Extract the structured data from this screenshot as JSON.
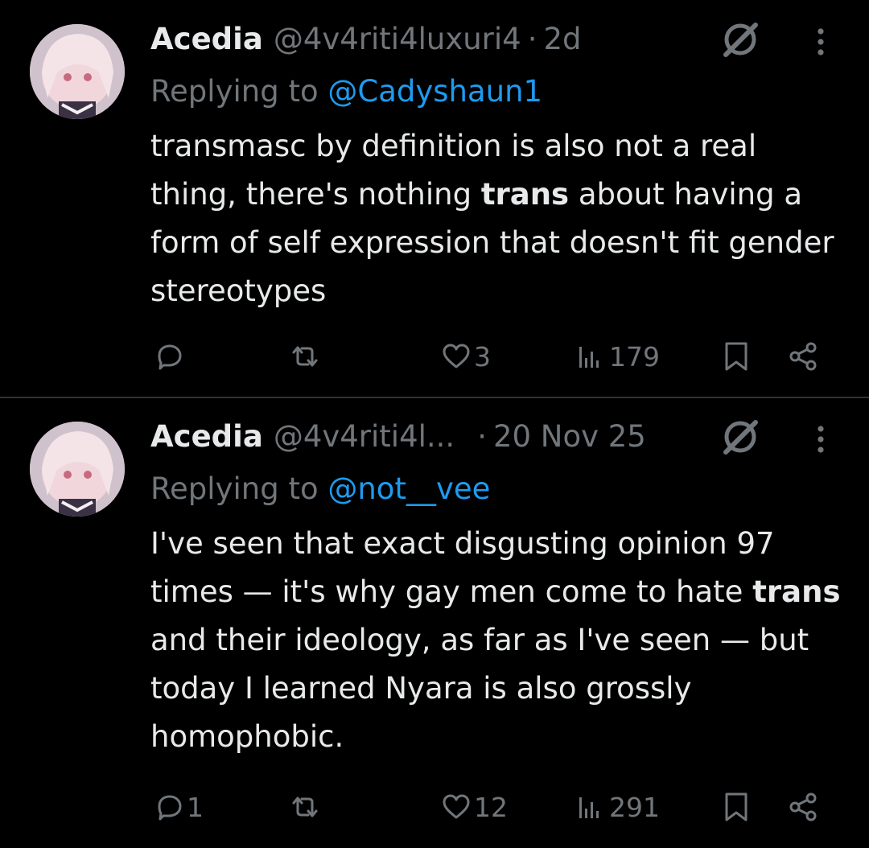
{
  "tweets": [
    {
      "name": "Acedia",
      "handle": "@4v4riti4luxuri4",
      "dot": "·",
      "time": "2d",
      "replying_prefix": "Replying to ",
      "replying_to": "@Cadyshaun1",
      "text_segments": [
        "transmasc by definition is also not a real thing, there's nothing ",
        "trans",
        " about having a form of self expression that doesn't fit gender stereotypes"
      ],
      "reply_count": "",
      "retweet_count": "",
      "like_count": "3",
      "view_count": "179"
    },
    {
      "name": "Acedia",
      "handle": "@4v4riti4l...",
      "dot": "·",
      "time": "20 Nov 25",
      "replying_prefix": "Replying to ",
      "replying_to": "@not__vee",
      "text_segments": [
        "I've seen that exact disgusting opinion 97 times — it's why gay men come to hate ",
        "trans",
        " and their ideology, as far as I've seen — but today I learned Nyara is also grossly homophobic."
      ],
      "reply_count": "1",
      "retweet_count": "",
      "like_count": "12",
      "view_count": "291"
    }
  ],
  "icons": {
    "reply": "reply-bubble-icon",
    "retweet": "retweet-icon",
    "like": "heart-icon",
    "views": "views-bar-chart-icon",
    "bookmark": "bookmark-icon",
    "share": "share-icon",
    "grok": "grok-slash-circle-icon",
    "more": "more-vertical-dots-icon"
  },
  "colors": {
    "background": "#000000",
    "text": "#e7e9ea",
    "secondary": "#71767b",
    "link": "#1d9bf0",
    "divider": "#2f3336"
  }
}
